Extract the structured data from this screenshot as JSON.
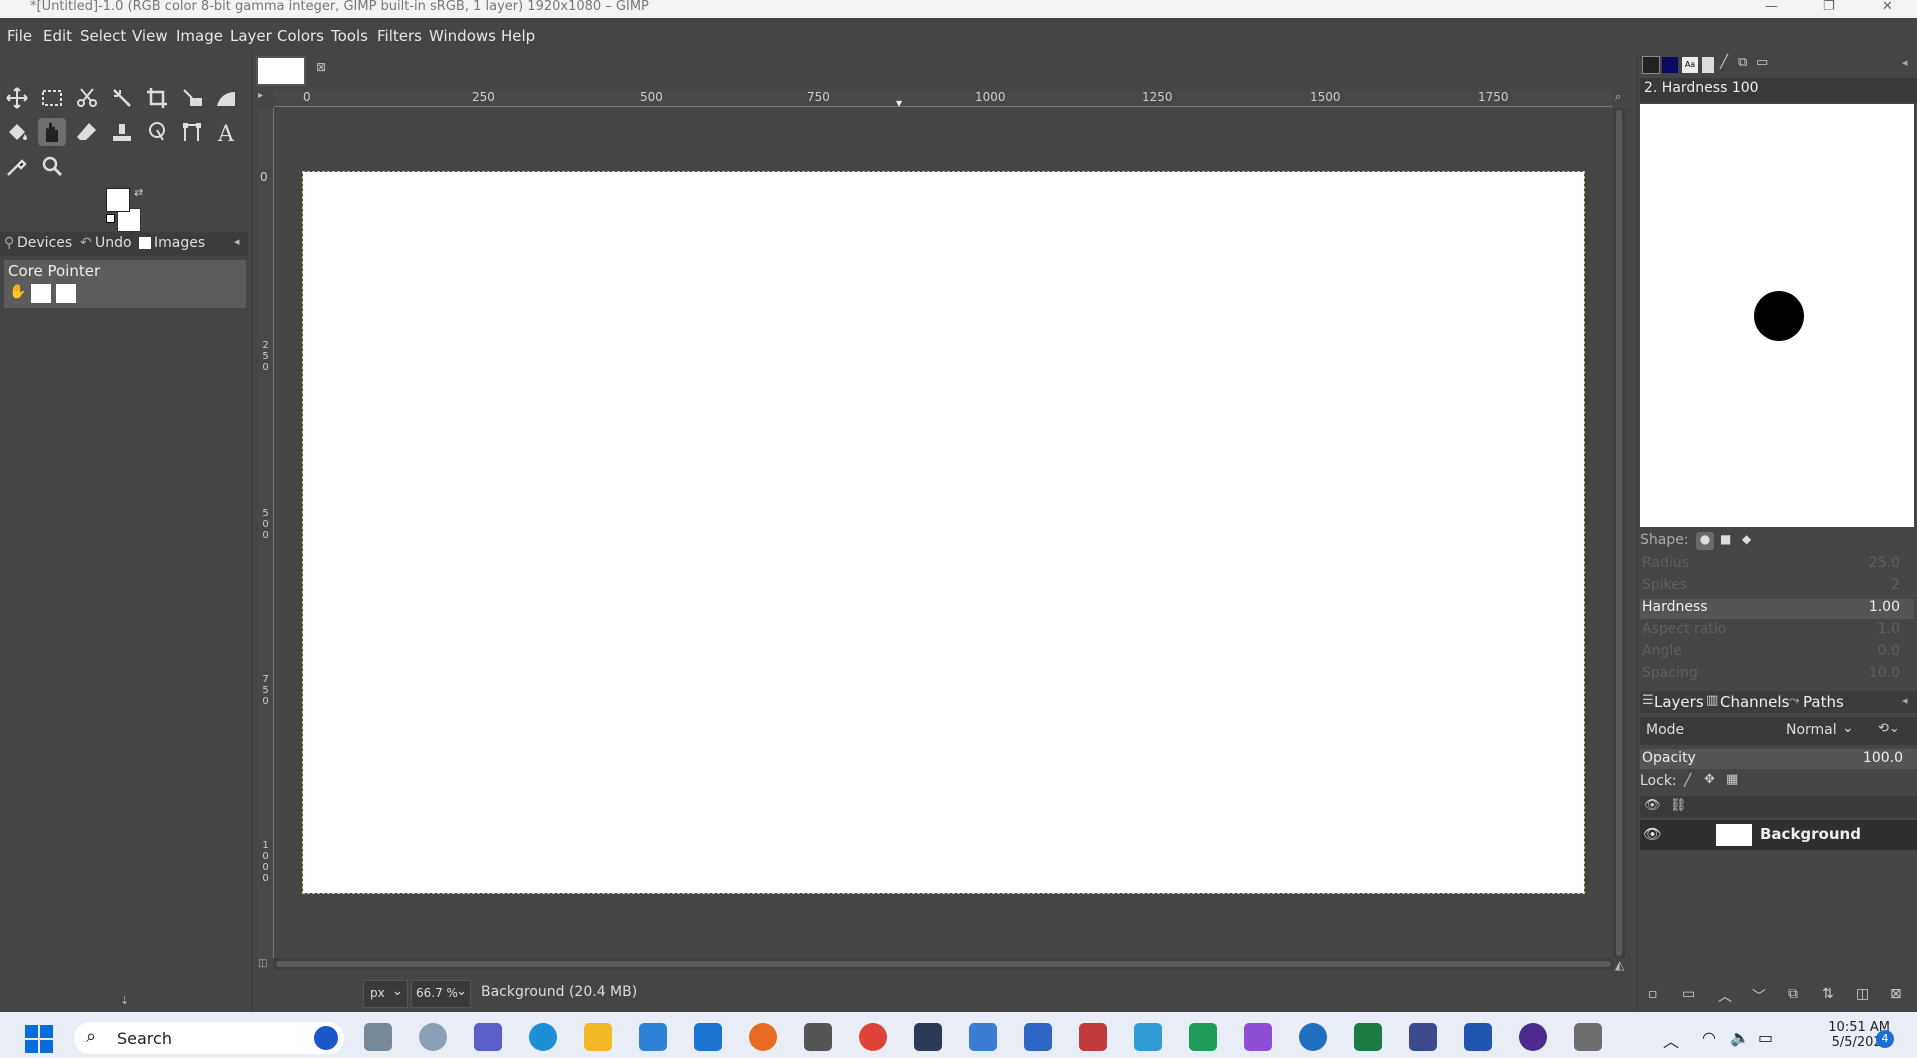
{
  "window": {
    "title": "*[Untitled]-1.0 (RGB color 8-bit gamma integer, GIMP built-in sRGB, 1 layer) 1920x1080 – GIMP"
  },
  "menu": [
    "File",
    "Edit",
    "Select",
    "View",
    "Image",
    "Layer",
    "Colors",
    "Tools",
    "Filters",
    "Windows",
    "Help"
  ],
  "toolbox": {
    "dock_tabs": [
      "Devices",
      "Undo",
      "Images"
    ],
    "device_name": "Core Pointer"
  },
  "ruler": {
    "h_ticks": [
      "0",
      "250",
      "500",
      "750",
      "1000",
      "1250",
      "1500",
      "1750"
    ],
    "v_ticks": [
      "0",
      "250",
      "500",
      "750",
      "1000"
    ]
  },
  "status": {
    "unit": "px",
    "zoom": "66.7 %",
    "message": "Background (20.4 MB)"
  },
  "brush": {
    "name": "2. Hardness 100",
    "shape_label": "Shape:",
    "props": [
      {
        "label": "Radius",
        "value": "25.0",
        "dim": true
      },
      {
        "label": "Spikes",
        "value": "2",
        "dim": true
      },
      {
        "label": "Hardness",
        "value": "1.00",
        "dim": false
      },
      {
        "label": "Aspect ratio",
        "value": "1.0",
        "dim": true
      },
      {
        "label": "Angle",
        "value": "0.0",
        "dim": true
      },
      {
        "label": "Spacing",
        "value": "10.0",
        "dim": true
      }
    ]
  },
  "layers": {
    "tabs": [
      "Layers",
      "Channels",
      "Paths"
    ],
    "mode_label": "Mode",
    "mode_value": "Normal",
    "opacity_label": "Opacity",
    "opacity_value": "100.0",
    "lock_label": "Lock:",
    "layer_name": "Background"
  },
  "taskbar": {
    "search": "Search",
    "time": "10:51 AM",
    "date": "5/5/2023",
    "badge": "4"
  }
}
